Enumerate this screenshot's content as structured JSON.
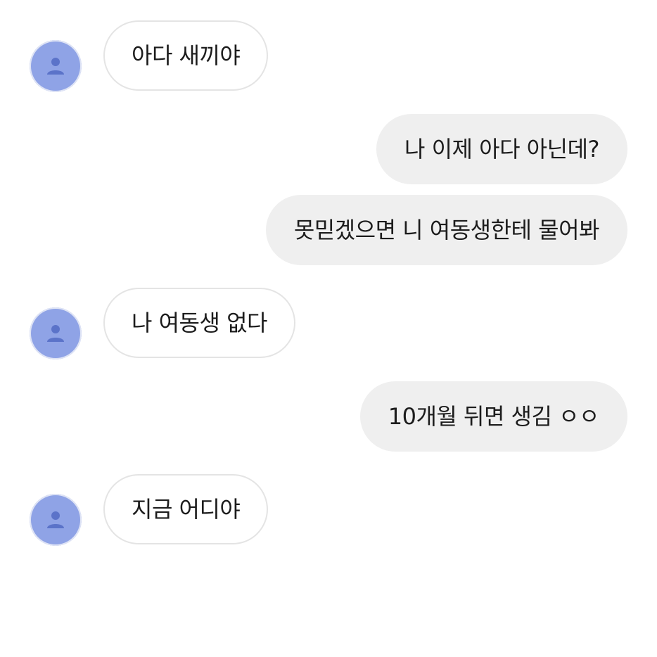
{
  "colors": {
    "background": "#ffffff",
    "incoming_bubble": "#ffffff",
    "incoming_border": "#e4e4e4",
    "outgoing_bubble": "#efefef",
    "avatar": "#8fa3e6",
    "text": "#1c1c1c"
  },
  "messages": [
    {
      "sender": "other",
      "text": "아다 새끼야",
      "avatar_icon": "person-icon"
    },
    {
      "sender": "me",
      "text": "나 이제 아다 아닌데?"
    },
    {
      "sender": "me",
      "text": "못믿겠으면 니 여동생한테 물어봐"
    },
    {
      "sender": "other",
      "text": "나 여동생 없다",
      "avatar_icon": "person-icon"
    },
    {
      "sender": "me",
      "text": "10개월 뒤면 생김 ㅇㅇ"
    },
    {
      "sender": "other",
      "text": "지금 어디야",
      "avatar_icon": "person-icon"
    }
  ]
}
